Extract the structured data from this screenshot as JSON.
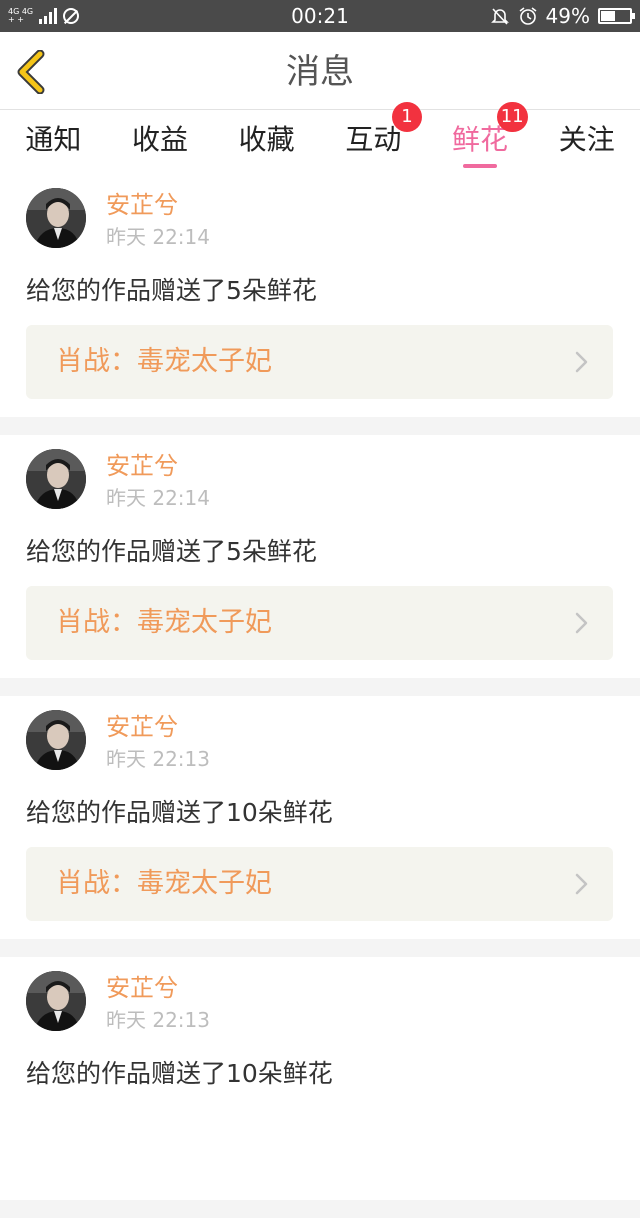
{
  "status_bar": {
    "network_top": "4G 4G",
    "network_bottom": "+ + ",
    "time": "00:21",
    "battery": "49%",
    "battery_level": 0.49
  },
  "header": {
    "title": "消息"
  },
  "tabs": [
    {
      "label": "通知",
      "badge": "",
      "active": false
    },
    {
      "label": "收益",
      "badge": "",
      "active": false
    },
    {
      "label": "收藏",
      "badge": "",
      "active": false
    },
    {
      "label": "互动",
      "badge": "1",
      "active": false
    },
    {
      "label": "鲜花",
      "badge": "11",
      "active": true
    },
    {
      "label": "关注",
      "badge": "",
      "active": false
    }
  ],
  "items": [
    {
      "user": "安芷兮",
      "time": "昨天 22:14",
      "message": "给您的作品赠送了5朵鲜花",
      "work": "肖战：毒宠太子妃"
    },
    {
      "user": "安芷兮",
      "time": "昨天 22:14",
      "message": "给您的作品赠送了5朵鲜花",
      "work": "肖战：毒宠太子妃"
    },
    {
      "user": "安芷兮",
      "time": "昨天 22:13",
      "message": "给您的作品赠送了10朵鲜花",
      "work": "肖战：毒宠太子妃"
    },
    {
      "user": "安芷兮",
      "time": "昨天 22:13",
      "message": "给您的作品赠送了10朵鲜花",
      "work": ""
    }
  ],
  "colors": {
    "accent": "#f06a9e",
    "name": "#f09a5a",
    "badge": "#f2323f",
    "back": "#f5c518"
  }
}
